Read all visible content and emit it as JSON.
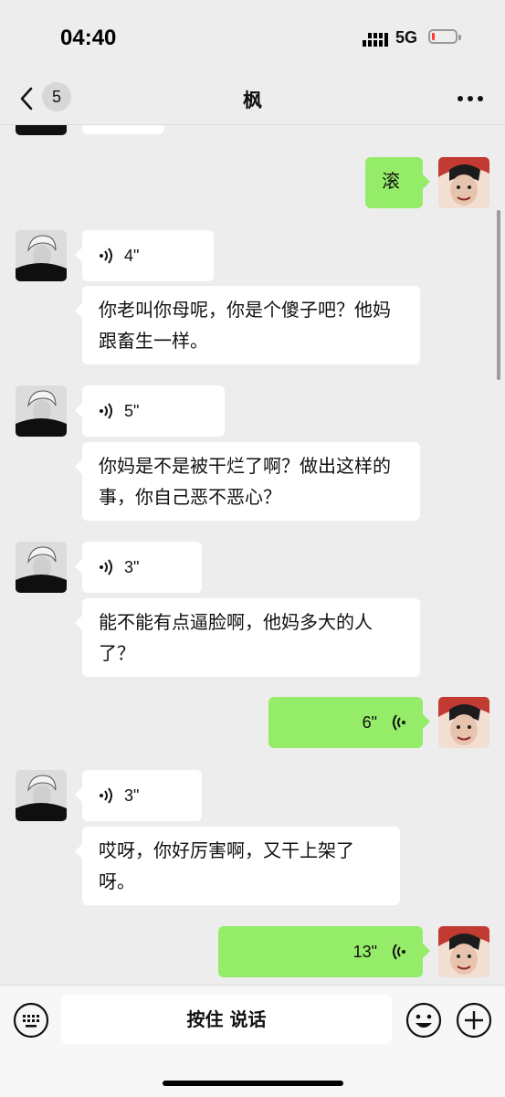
{
  "status_bar": {
    "time": "04:40",
    "network": "5G"
  },
  "nav": {
    "unread_count": "5",
    "title": "枫"
  },
  "messages": [
    {
      "side": "left",
      "type": "text",
      "text": ""
    },
    {
      "side": "right",
      "type": "text",
      "text": "滚"
    },
    {
      "side": "left",
      "type": "voice",
      "duration": "4\""
    },
    {
      "side": "left",
      "type": "text",
      "text": "你老叫你母呢，你是个傻子吧？他妈跟畜生一样。"
    },
    {
      "side": "left",
      "type": "voice",
      "duration": "5\""
    },
    {
      "side": "left",
      "type": "text",
      "text": "你妈是不是被干烂了啊？做出这样的事，你自己恶不恶心？"
    },
    {
      "side": "left",
      "type": "voice",
      "duration": "3\""
    },
    {
      "side": "left",
      "type": "text",
      "text": "能不能有点逼脸啊，他妈多大的人了？"
    },
    {
      "side": "right",
      "type": "voice",
      "duration": "6\""
    },
    {
      "side": "left",
      "type": "voice",
      "duration": "3\""
    },
    {
      "side": "left",
      "type": "text",
      "text": "哎呀，你好厉害啊，又干上架了呀。"
    },
    {
      "side": "right",
      "type": "voice",
      "duration": "13\""
    }
  ],
  "input_bar": {
    "hold_to_talk_label": "按住 说话"
  },
  "colors": {
    "background": "#ededed",
    "sent_bubble": "#95ec69",
    "received_bubble": "#ffffff",
    "battery_low": "#ff3b30"
  },
  "icons": {
    "back": "chevron-left-icon",
    "more": "more-dots-icon",
    "keyboard": "keyboard-icon",
    "emoji": "emoji-icon",
    "plus": "plus-icon",
    "voice": "voice-wave-icon"
  }
}
